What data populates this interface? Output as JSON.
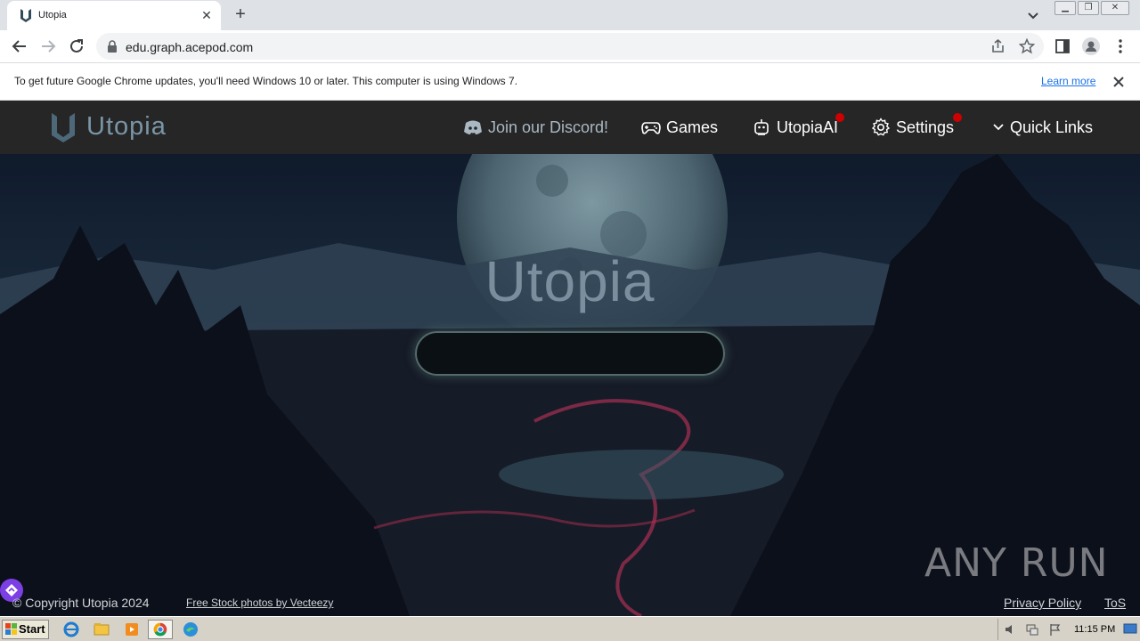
{
  "browser": {
    "tab": {
      "title": "Utopia"
    },
    "url": "edu.graph.acepod.com",
    "infobar": {
      "message": "To get future Google Chrome updates, you'll need Windows 10 or later. This computer is using Windows 7.",
      "learn_more": "Learn more"
    }
  },
  "site": {
    "brand": "Utopia",
    "nav": {
      "discord": "Join our Discord!",
      "games": "Games",
      "ai": "UtopiaAI",
      "settings": "Settings",
      "quick_links": "Quick Links"
    },
    "hero": {
      "title": "Utopia",
      "search_value": ""
    },
    "footer": {
      "copyright": "© Copyright Utopia 2024",
      "credit": "Free Stock photos by Vecteezy",
      "privacy": "Privacy Policy",
      "tos": "ToS"
    },
    "watermark": "ANY RUN",
    "colors": {
      "nav_bg": "#262626",
      "notification": "#d00000",
      "brand": "#7a95a6"
    }
  },
  "taskbar": {
    "start": "Start",
    "clock": "11:15 PM"
  }
}
